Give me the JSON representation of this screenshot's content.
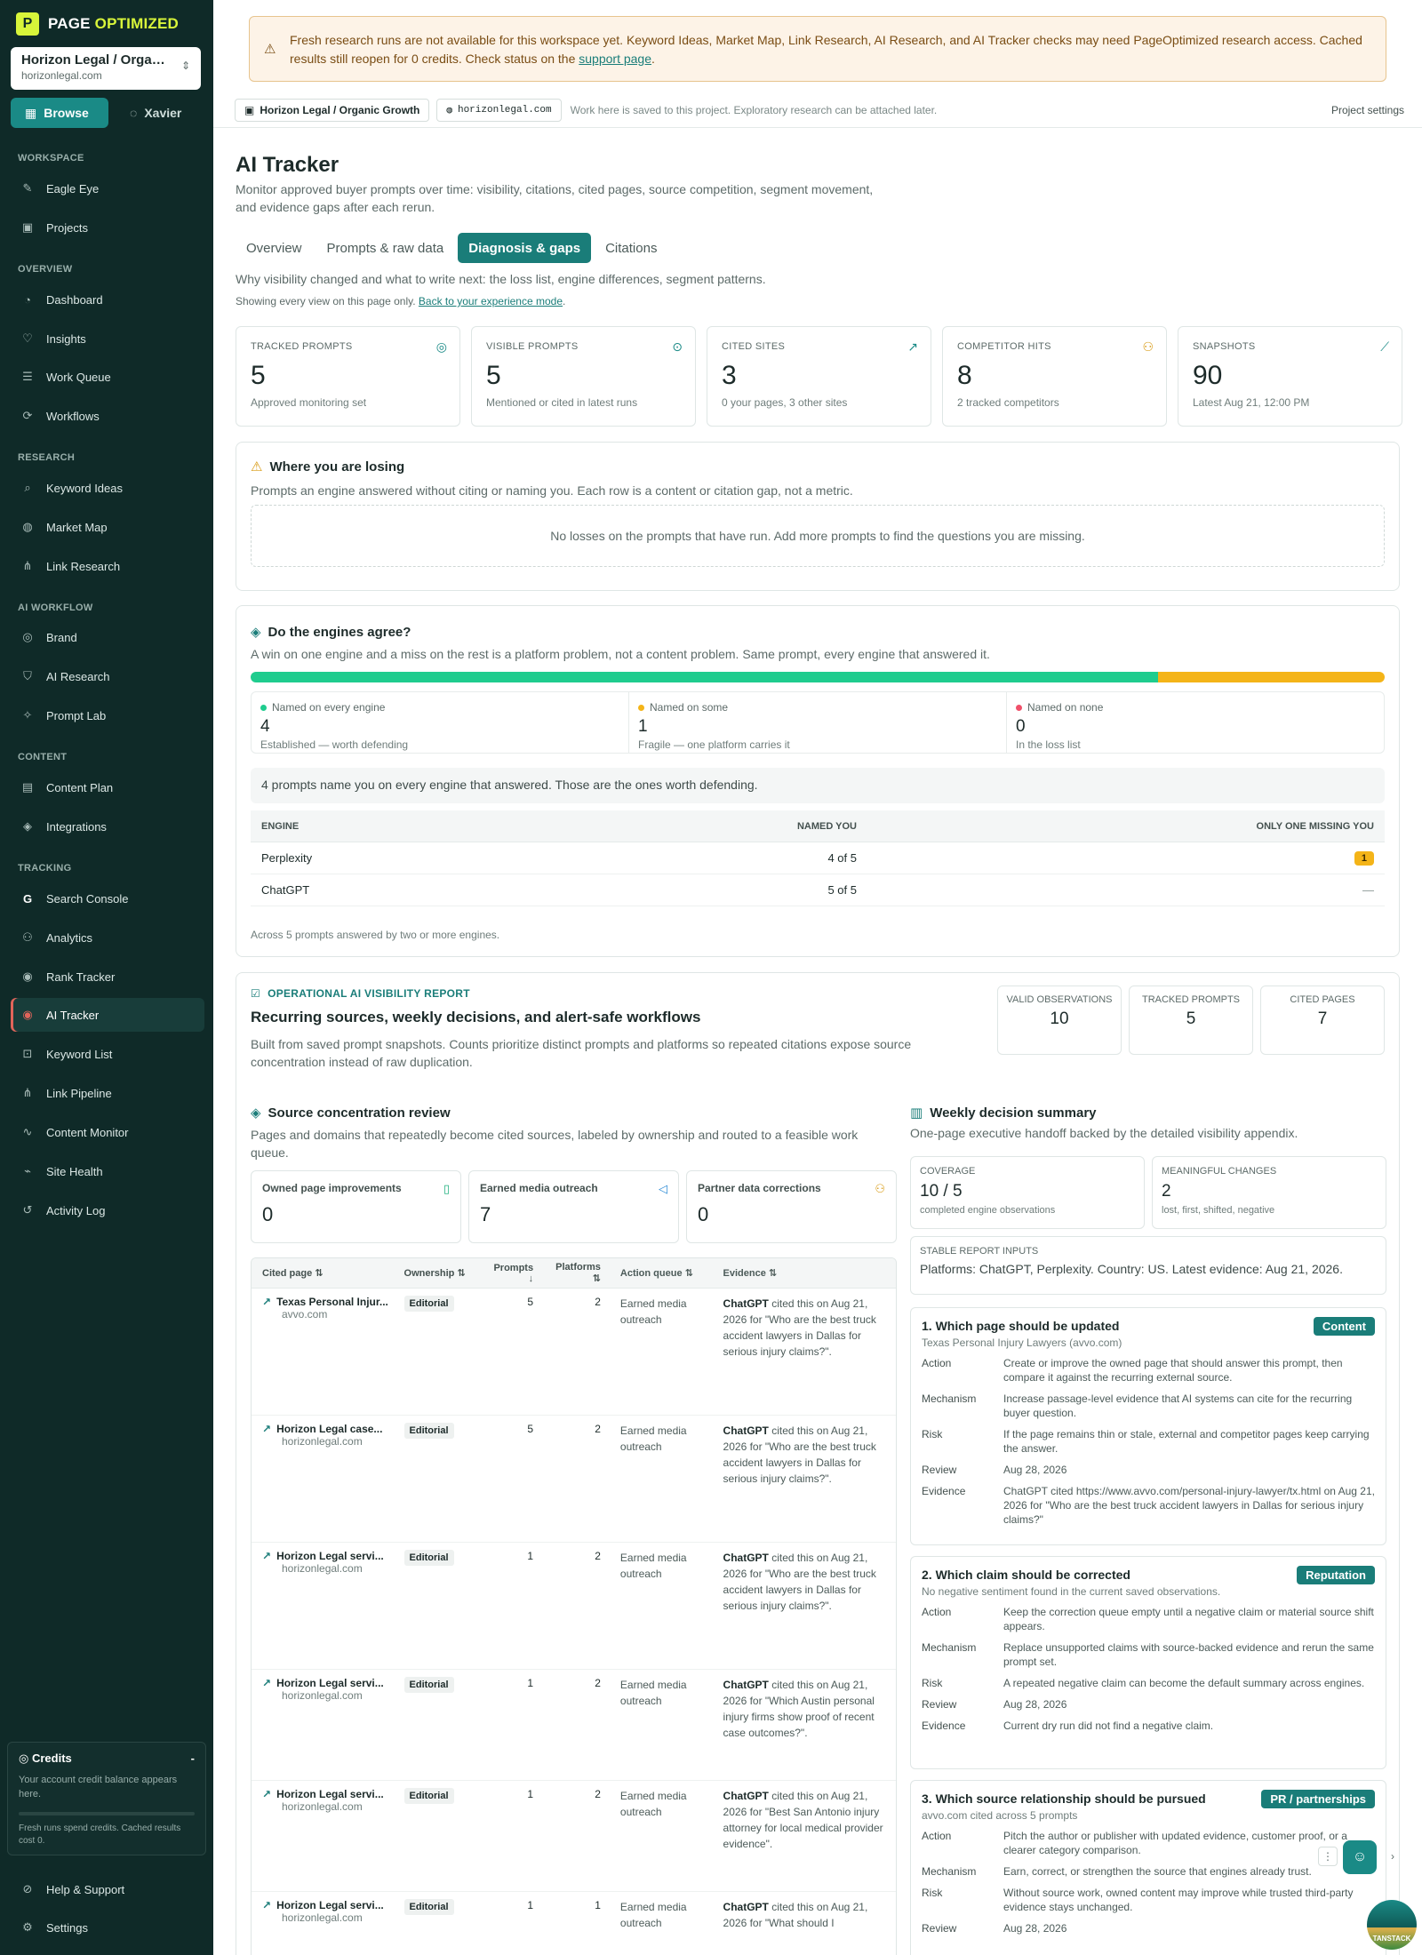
{
  "brand": {
    "name_a": "PAGE ",
    "name_b": "OPTIMIZED",
    "mark": "P"
  },
  "project_selector": {
    "title": "Horizon Legal / Organic Growth",
    "domain": "horizonlegal.com"
  },
  "modes": [
    {
      "label": "Browse"
    },
    {
      "label": "Xavier"
    }
  ],
  "nav": {
    "workspace_label": "WORKSPACE",
    "workspace": [
      {
        "label": "Eagle Eye"
      },
      {
        "label": "Projects"
      }
    ],
    "overview_label": "OVERVIEW",
    "overview": [
      {
        "label": "Dashboard"
      },
      {
        "label": "Insights"
      },
      {
        "label": "Work Queue"
      },
      {
        "label": "Workflows"
      }
    ],
    "research_label": "RESEARCH",
    "research": [
      {
        "label": "Keyword Ideas"
      },
      {
        "label": "Market Map"
      },
      {
        "label": "Link Research"
      }
    ],
    "ai_label": "AI WORKFLOW",
    "ai": [
      {
        "label": "Brand"
      },
      {
        "label": "AI Research"
      },
      {
        "label": "Prompt Lab"
      }
    ],
    "content_label": "CONTENT",
    "content": [
      {
        "label": "Content Plan"
      },
      {
        "label": "Integrations"
      }
    ],
    "tracking_label": "TRACKING",
    "tracking": [
      {
        "label": "Search Console"
      },
      {
        "label": "Analytics"
      },
      {
        "label": "Rank Tracker"
      },
      {
        "label": "AI Tracker"
      },
      {
        "label": "Keyword List"
      },
      {
        "label": "Link Pipeline"
      },
      {
        "label": "Content Monitor"
      },
      {
        "label": "Site Health"
      },
      {
        "label": "Activity Log"
      }
    ],
    "help": "Help & Support",
    "settings": "Settings"
  },
  "credits": {
    "title": "Credits",
    "collapse": "-",
    "desc": "Your account credit balance appears here.",
    "note": "Fresh runs spend credits. Cached results cost 0."
  },
  "banner": {
    "text": "Fresh research runs are not available for this workspace yet. Keyword Ideas, Market Map, Link Research, AI Research, and AI Tracker checks may need PageOptimized research access. Cached results still reopen for 0 credits. Check status on the ",
    "link": "support page",
    "end": "."
  },
  "topbar": {
    "project": "Horizon Legal / Organic Growth",
    "domain": "horizonlegal.com",
    "note": "Work here is saved to this project. Exploratory research can be attached later.",
    "settings": "Project settings"
  },
  "page": {
    "title": "AI Tracker",
    "desc": "Monitor approved buyer prompts over time: visibility, citations, cited pages, source competition, segment movement, and evidence gaps after each rerun.",
    "tabs": [
      {
        "label": "Overview"
      },
      {
        "label": "Prompts & raw data"
      },
      {
        "label": "Diagnosis & gaps"
      },
      {
        "label": "Citations"
      }
    ],
    "tab_desc": "Why visibility changed and what to write next: the loss list, engine differences, segment patterns.",
    "tab_note": "Showing every view on this page only. ",
    "tab_note_link": "Back to your experience mode",
    "tab_note_end": "."
  },
  "kpis": [
    {
      "label": "TRACKED PROMPTS",
      "value": "5",
      "sub": "Approved monitoring set",
      "icon": "target-icon"
    },
    {
      "label": "VISIBLE PROMPTS",
      "value": "5",
      "sub": "Mentioned or cited in latest runs",
      "icon": "check-circle-icon"
    },
    {
      "label": "CITED SITES",
      "value": "3",
      "sub": "0 your pages, 3 other sites",
      "icon": "external-link-icon"
    },
    {
      "label": "COMPETITOR HITS",
      "value": "8",
      "sub": "2 tracked competitors",
      "icon": "users-icon"
    },
    {
      "label": "SNAPSHOTS",
      "value": "90",
      "sub": "Latest Aug 21, 12:00 PM",
      "icon": "chart-icon"
    }
  ],
  "losing": {
    "title": "Where you are losing",
    "desc": "Prompts an engine answered without citing or naming you. Each row is a content or citation gap, not a metric.",
    "empty": "No losses on the prompts that have run. Add more prompts to find the questions you are missing."
  },
  "agree": {
    "title": "Do the engines agree?",
    "desc": "A win on one engine and a miss on the rest is a platform problem, not a content problem. Same prompt, every engine that answered it.",
    "split": {
      "every": 4,
      "some": 1,
      "none": 0
    },
    "cells": [
      {
        "label": "Named on every engine",
        "value": "4",
        "sub": "Established — worth defending",
        "color": "#1fcc8e"
      },
      {
        "label": "Named on some",
        "value": "1",
        "sub": "Fragile — one platform carries it",
        "color": "#f4b418"
      },
      {
        "label": "Named on none",
        "value": "0",
        "sub": "In the loss list",
        "color": "#f0506a"
      }
    ],
    "message": "4 prompts name you on every engine that answered. Those are the ones worth defending.",
    "columns": [
      "ENGINE",
      "NAMED YOU",
      "ONLY ONE MISSING YOU"
    ],
    "rows": [
      {
        "engine": "Perplexity",
        "named": "4 of 5",
        "missing": "1"
      },
      {
        "engine": "ChatGPT",
        "named": "5 of 5",
        "missing": "—"
      }
    ],
    "footer": "Across 5 prompts answered by two or more engines."
  },
  "report": {
    "tag": "OPERATIONAL AI VISIBILITY REPORT",
    "title": "Recurring sources, weekly decisions, and alert-safe workflows",
    "desc": "Built from saved prompt snapshots. Counts prioritize distinct prompts and platforms so repeated citations expose source concentration instead of raw duplication.",
    "stats": [
      {
        "label": "VALID OBSERVATIONS",
        "value": "10"
      },
      {
        "label": "TRACKED PROMPTS",
        "value": "5"
      },
      {
        "label": "CITED PAGES",
        "value": "7"
      }
    ]
  },
  "source": {
    "title": "Source concentration review",
    "desc": "Pages and domains that repeatedly become cited sources, labeled by ownership and routed to a feasible work queue.",
    "queues": [
      {
        "label": "Owned page improvements",
        "value": "0",
        "icon": "file-icon"
      },
      {
        "label": "Earned media outreach",
        "value": "7",
        "icon": "megaphone-icon"
      },
      {
        "label": "Partner data corrections",
        "value": "0",
        "icon": "user-plus-icon"
      }
    ],
    "columns": [
      "Cited page ⇅",
      "Ownership ⇅",
      "Prompts ↓",
      "Platforms ⇅",
      "Action queue ⇅",
      "Evidence ⇅"
    ],
    "rows": [
      {
        "page": "Texas Personal Injur...",
        "domain": "avvo.com",
        "ownership": "Editorial",
        "prompts": "5",
        "platforms": "2",
        "queue": "Earned media outreach",
        "ev_engine": "ChatGPT",
        "ev_text": " cited this on Aug 21, 2026 for \"Who are the best truck accident lawyers in Dallas for serious injury claims?\"."
      },
      {
        "page": "Horizon Legal case...",
        "domain": "horizonlegal.com",
        "ownership": "Editorial",
        "prompts": "5",
        "platforms": "2",
        "queue": "Earned media outreach",
        "ev_engine": "ChatGPT",
        "ev_text": " cited this on Aug 21, 2026 for \"Who are the best truck accident lawyers in Dallas for serious injury claims?\"."
      },
      {
        "page": "Horizon Legal servi...",
        "domain": "horizonlegal.com",
        "ownership": "Editorial",
        "prompts": "1",
        "platforms": "2",
        "queue": "Earned media outreach",
        "ev_engine": "ChatGPT",
        "ev_text": " cited this on Aug 21, 2026 for \"Who are the best truck accident lawyers in Dallas for serious injury claims?\"."
      },
      {
        "page": "Horizon Legal servi...",
        "domain": "horizonlegal.com",
        "ownership": "Editorial",
        "prompts": "1",
        "platforms": "2",
        "queue": "Earned media outreach",
        "ev_engine": "ChatGPT",
        "ev_text": " cited this on Aug 21, 2026 for \"Which Austin personal injury firms show proof of recent case outcomes?\"."
      },
      {
        "page": "Horizon Legal servi...",
        "domain": "horizonlegal.com",
        "ownership": "Editorial",
        "prompts": "1",
        "platforms": "2",
        "queue": "Earned media outreach",
        "ev_engine": "ChatGPT",
        "ev_text": " cited this on Aug 21, 2026 for \"Best San Antonio injury attorney for local medical provider evidence\"."
      },
      {
        "page": "Horizon Legal servi...",
        "domain": "horizonlegal.com",
        "ownership": "Editorial",
        "prompts": "1",
        "platforms": "1",
        "queue": "Earned media outreach",
        "ev_engine": "ChatGPT",
        "ev_text": " cited this on Aug 21, 2026 for \"What should I"
      }
    ]
  },
  "weekly": {
    "title": "Weekly decision summary",
    "desc": "One-page executive handoff backed by the detailed visibility appendix.",
    "stats": [
      {
        "label": "COVERAGE",
        "value": "10 / 5",
        "sub": "completed engine observations"
      },
      {
        "label": "MEANINGFUL CHANGES",
        "value": "2",
        "sub": "lost, first, shifted, negative"
      }
    ],
    "inputs_label": "STABLE REPORT INPUTS",
    "inputs": "Platforms: ChatGPT, Perplexity. Country: US. Latest evidence: Aug 21, 2026.",
    "decisions": [
      {
        "title": "1. Which page should be updated",
        "tag": "Content",
        "sub": "Texas Personal Injury Lawyers (avvo.com)",
        "rows": [
          {
            "k": "Action",
            "v": "Create or improve the owned page that should answer this prompt, then compare it against the recurring external source."
          },
          {
            "k": "Mechanism",
            "v": "Increase passage-level evidence that AI systems can cite for the recurring buyer question."
          },
          {
            "k": "Risk",
            "v": "If the page remains thin or stale, external and competitor pages keep carrying the answer."
          },
          {
            "k": "Review",
            "v": "Aug 28, 2026"
          },
          {
            "k": "Evidence",
            "v": "ChatGPT cited https://www.avvo.com/personal-injury-lawyer/tx.html on Aug 21, 2026 for \"Who are the best truck accident lawyers in Dallas for serious injury claims?\""
          }
        ]
      },
      {
        "title": "2. Which claim should be corrected",
        "tag": "Reputation",
        "sub": "No negative sentiment found in the current saved observations.",
        "rows": [
          {
            "k": "Action",
            "v": "Keep the correction queue empty until a negative claim or material source shift appears."
          },
          {
            "k": "Mechanism",
            "v": "Replace unsupported claims with source-backed evidence and rerun the same prompt set."
          },
          {
            "k": "Risk",
            "v": "A repeated negative claim can become the default summary across engines."
          },
          {
            "k": "Review",
            "v": "Aug 28, 2026"
          },
          {
            "k": "Evidence",
            "v": "Current dry run did not find a negative claim."
          }
        ]
      },
      {
        "title": "3. Which source relationship should be pursued",
        "tag": "PR / partnerships",
        "sub": "avvo.com cited across 5 prompts",
        "rows": [
          {
            "k": "Action",
            "v": "Pitch the author or publisher with updated evidence, customer proof, or a clearer category comparison."
          },
          {
            "k": "Mechanism",
            "v": "Earn, correct, or strengthen the source that engines already trust."
          },
          {
            "k": "Risk",
            "v": "Without source work, owned content may improve while trusted third-party evidence stays unchanged."
          },
          {
            "k": "Review",
            "v": "Aug 28, 2026"
          }
        ]
      }
    ]
  },
  "widgets": {
    "stamp": "TANSTACK"
  }
}
